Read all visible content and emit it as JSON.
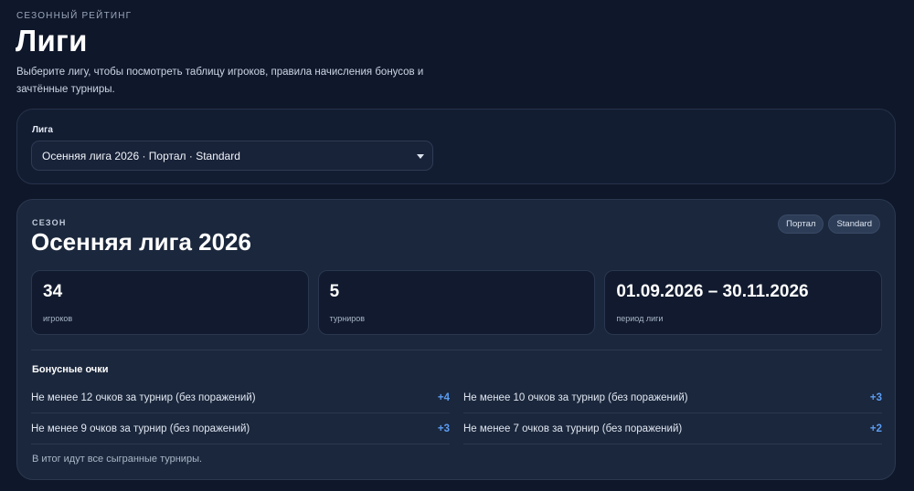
{
  "header": {
    "eyebrow": "СЕЗОННЫЙ РЕЙТИНГ",
    "title": "Лиги",
    "description": "Выберите лигу, чтобы посмотреть таблицу игроков, правила начисления бонусов и зачтённые турниры."
  },
  "league_select": {
    "label": "Лига",
    "value": "Осенняя лига 2026 · Портал · Standard"
  },
  "season": {
    "eyebrow": "СЕЗОН",
    "title": "Осенняя лига 2026",
    "tags": [
      "Портал",
      "Standard"
    ],
    "stats": [
      {
        "value": "34",
        "label": "игроков"
      },
      {
        "value": "5",
        "label": "турниров"
      },
      {
        "value": "01.09.2026 – 30.11.2026",
        "label": "период лиги"
      }
    ],
    "bonus": {
      "title": "Бонусные очки",
      "rows": [
        {
          "text": "Не менее 12 очков за турнир (без поражений)",
          "points": "+4"
        },
        {
          "text": "Не менее 10 очков за турнир (без поражений)",
          "points": "+3"
        },
        {
          "text": "Не менее 9 очков за турнир (без поражений)",
          "points": "+3"
        },
        {
          "text": "Не менее 7 очков за турнир (без поражений)",
          "points": "+2"
        }
      ],
      "footer": "В итог идут все сыгранные турниры."
    }
  },
  "colors": {
    "background": "#0f172a",
    "card": "#131d32",
    "season_card": "#1b273c",
    "accent": "#5b9cf2"
  }
}
